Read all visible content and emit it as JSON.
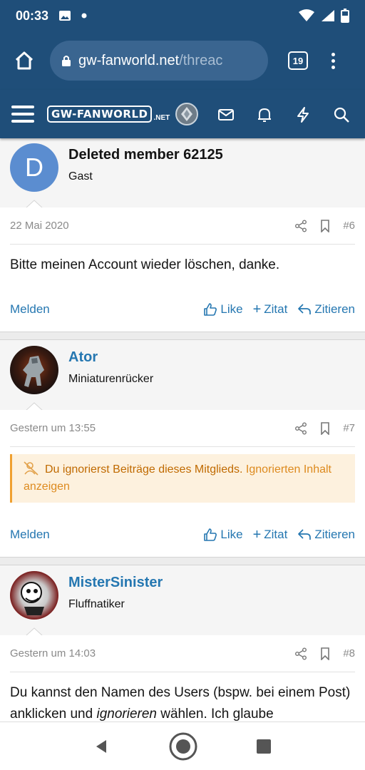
{
  "status": {
    "time": "00:33"
  },
  "browser": {
    "url_host": "gw-fanworld.net",
    "url_path": "/threac",
    "tab_count": "19"
  },
  "site": {
    "logo_main": "GW-FANWORLD",
    "logo_suffix": ".NET"
  },
  "posts": [
    {
      "username": "Deleted member 62125",
      "avatar_letter": "D",
      "user_title": "Gast",
      "date": "22 Mai 2020",
      "number": "#6",
      "text": "Bitte meinen Account wieder löschen, danke.",
      "report": "Melden",
      "like": "Like",
      "quote": "Zitat",
      "reply": "Zitieren"
    },
    {
      "username": "Ator",
      "user_title": "Miniaturenrücker",
      "date": "Gestern um 13:55",
      "number": "#7",
      "ignore_text": "Du ignorierst Beiträge dieses Mitglieds.",
      "ignore_link": "Ignorierten Inhalt anzeigen",
      "report": "Melden",
      "like": "Like",
      "quote": "Zitat",
      "reply": "Zitieren"
    },
    {
      "username": "MisterSinister",
      "user_title": "Fluffnatiker",
      "date": "Gestern um 14:03",
      "number": "#8",
      "text_part1": "Du kannst den Namen des Users (bspw. bei einem Post) anklicken und ",
      "text_em": "ignorieren",
      "text_part2": " wählen. Ich glaube"
    }
  ],
  "colors": {
    "header": "#1f4e79",
    "link": "#2577b1",
    "warning_bg": "#fdf1de",
    "warning_text": "#c06a00"
  }
}
